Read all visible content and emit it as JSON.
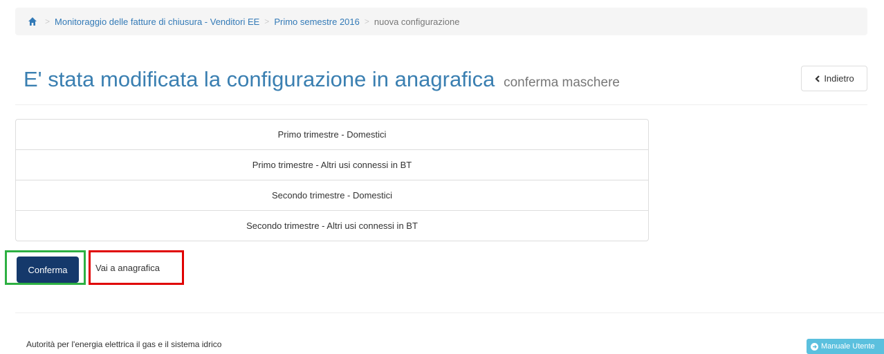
{
  "breadcrumb": {
    "home_icon": "home-icon",
    "items": [
      "Monitoraggio delle fatture di chiusura - Venditori EE",
      "Primo semestre 2016"
    ],
    "current": "nuova configurazione",
    "separator": ">"
  },
  "header": {
    "title": "E' stata modificata la configurazione in anagrafica",
    "subtitle": "conferma maschere",
    "back_label": "Indietro",
    "back_icon": "chevron-left-icon",
    "title_color": "#3a7fb1"
  },
  "list": {
    "items": [
      "Primo trimestre - Domestici",
      "Primo trimestre - Altri usi connessi in BT",
      "Secondo trimestre - Domestici",
      "Secondo trimestre - Altri usi connessi in BT"
    ]
  },
  "actions": {
    "confirm_label": "Conferma",
    "secondary_label": "Vai a anagrafica",
    "confirm_color": "#15396b",
    "confirm_highlight_color": "#2db042",
    "secondary_highlight_color": "#e00000"
  },
  "footer": {
    "text": "Autorità per l'energia elettrica il gas e il sistema idrico",
    "manual_label": "Manuale Utente",
    "manual_icon": "arrow-circle-icon",
    "manual_color": "#5bc0de"
  }
}
